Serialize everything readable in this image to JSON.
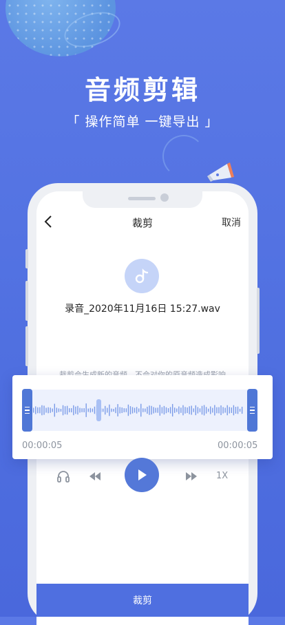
{
  "promo": {
    "title": "音频剪辑",
    "subtitle": "「 操作简单 一键导出 」"
  },
  "nav": {
    "title": "裁剪",
    "cancel_label": "取消"
  },
  "file": {
    "name": "录音_2020年11月16日 15:27.wav"
  },
  "hint": "裁剪会生成新的音频，不会对你的原音频造成影响",
  "trim": {
    "start_time": "00:00:05",
    "end_time": "00:00:05"
  },
  "player": {
    "speed_label": "1X"
  },
  "action": {
    "trim_label": "裁剪"
  },
  "colors": {
    "background": "#5b79e6",
    "accent": "#4f77d6",
    "waveform": "#7a9be8",
    "music_badge": "#c5d4f8"
  },
  "icons": [
    "back-icon",
    "music-note-icon",
    "headphones-icon",
    "rewind-icon",
    "play-icon",
    "fast-forward-icon",
    "megaphone-icon"
  ]
}
